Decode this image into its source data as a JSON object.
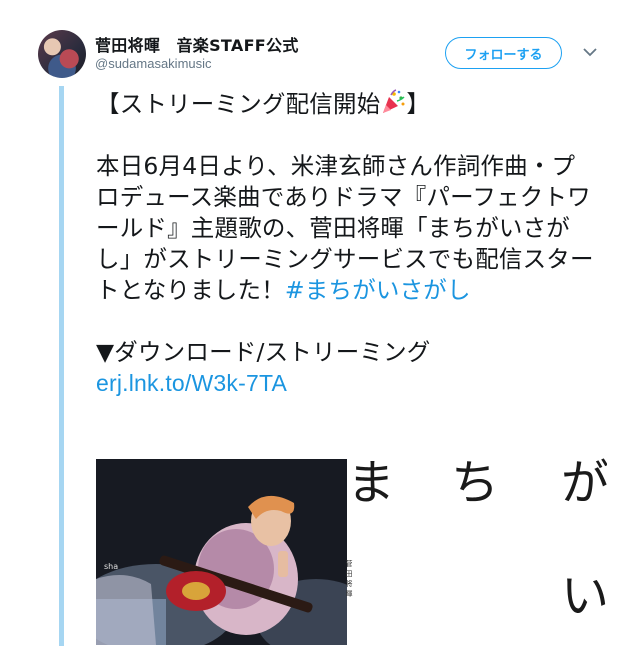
{
  "user": {
    "display_name": "菅田将暉　音楽STAFF公式",
    "handle": "@sudamasakimusic",
    "avatar_icon": "avatar-photo"
  },
  "actions": {
    "follow_label": "フォローする",
    "menu_icon": "chevron-down-icon"
  },
  "tweet": {
    "heading_open": "【ストリーミング配信開始",
    "heading_emoji": "party-popper-icon",
    "heading_close": "】",
    "body": "本日6月4日より、米津玄師さん作詞作曲・プロデュース楽曲でありドラマ『パーフェクトワールド』主題歌の、菅田将暉「まちがいさがし」がストリーミングサービスでも配信スタートとなりました！",
    "hashtag": "#まちがいさがし",
    "download_label": "▼ダウンロード/ストリーミング",
    "link": "erj.lnk.to/W3k-7TA"
  },
  "media": {
    "cover_chars": [
      "ま",
      "ち",
      "が",
      "い"
    ],
    "cover_artist": "菅田将暉"
  },
  "colors": {
    "accent": "#1da1f2",
    "link": "#1b95e0",
    "thread_line": "#a6d6f2",
    "muted": "#657786"
  }
}
